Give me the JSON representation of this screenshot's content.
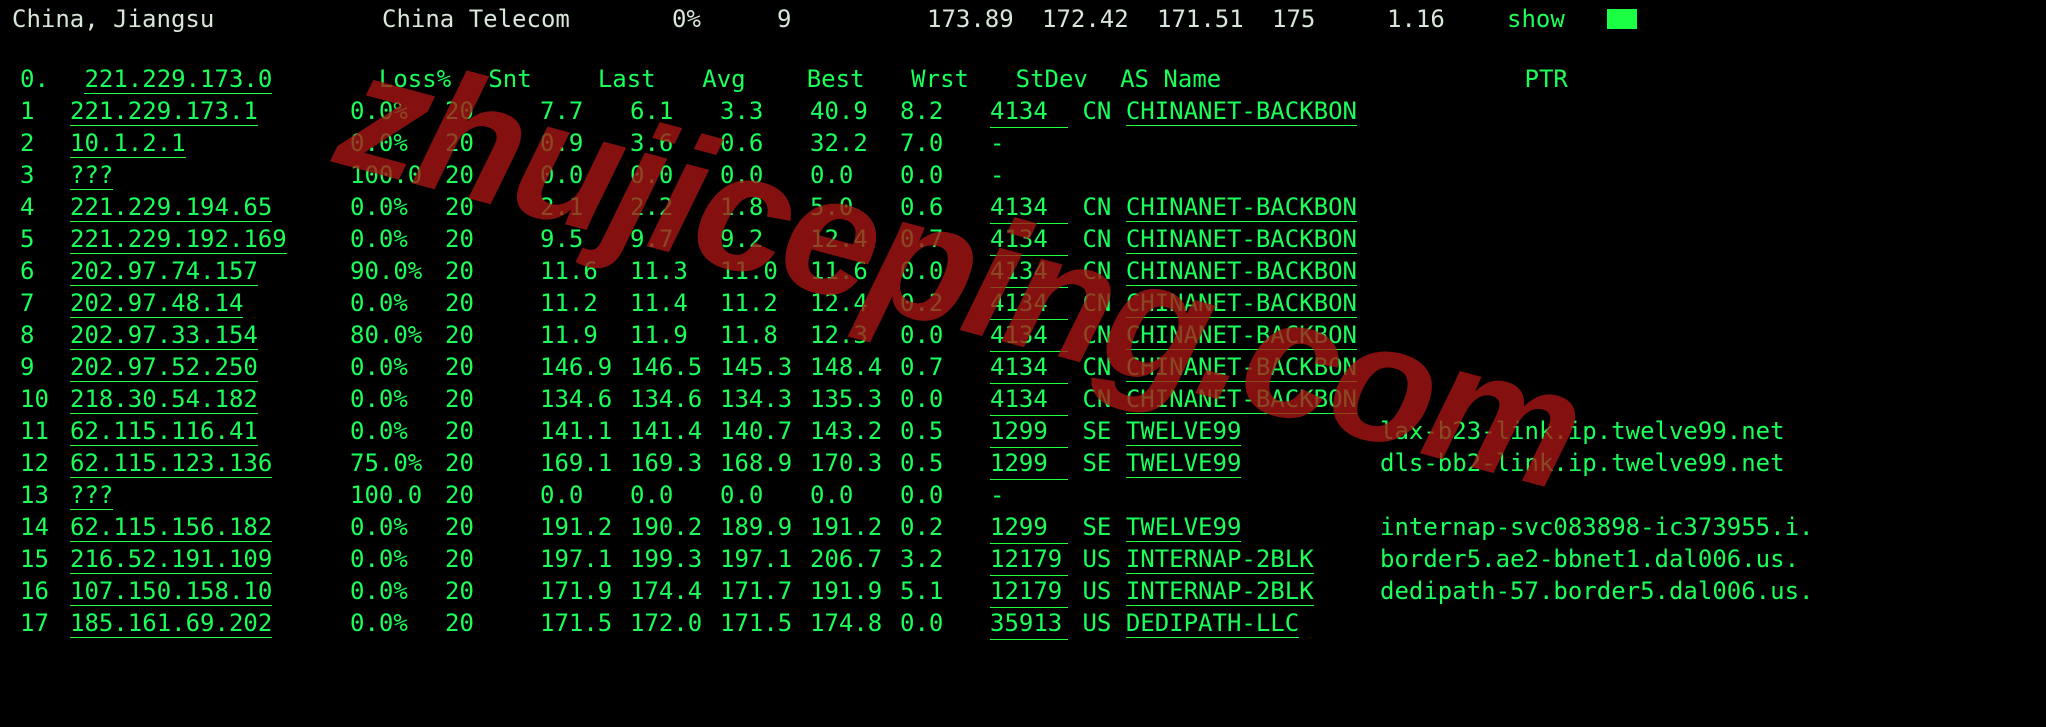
{
  "top": {
    "location": "China, Jiangsu",
    "isp": "China Telecom",
    "loss": "0%",
    "snt": "9",
    "last": "173.89",
    "avg": "172.42",
    "best": "171.51",
    "wrst": "175",
    "stdev": "1.16",
    "action": "show"
  },
  "headers": {
    "hop": "0.",
    "ip": "221.229.173.0",
    "loss": "Loss%",
    "snt": "Snt",
    "last": "Last",
    "avg": "Avg",
    "best": "Best",
    "wrst": "Wrst",
    "stdev": "StDev",
    "asname": "AS Name",
    "ptr": "PTR"
  },
  "hops": [
    {
      "n": "1",
      "ip": "221.229.173.1",
      "loss": "0.0%",
      "snt": "20",
      "last": "7.7",
      "avg": "6.1",
      "best": "3.3",
      "wrst": "40.9",
      "stdev": "8.2",
      "asn": "4134",
      "cc": "CN",
      "asname": "CHINANET-BACKBON",
      "ptr": ""
    },
    {
      "n": "2",
      "ip": "10.1.2.1",
      "loss": "0.0%",
      "snt": "20",
      "last": "0.9",
      "avg": "3.6",
      "best": "0.6",
      "wrst": "32.2",
      "stdev": "7.0",
      "asn": "-",
      "cc": "",
      "asname": "",
      "ptr": ""
    },
    {
      "n": "3",
      "ip": "???",
      "loss": "100.0",
      "snt": "20",
      "last": "0.0",
      "avg": "0.0",
      "best": "0.0",
      "wrst": "0.0",
      "stdev": "0.0",
      "asn": "-",
      "cc": "",
      "asname": "",
      "ptr": ""
    },
    {
      "n": "4",
      "ip": "221.229.194.65",
      "loss": "0.0%",
      "snt": "20",
      "last": "2.1",
      "avg": "2.2",
      "best": "1.8",
      "wrst": "5.0",
      "stdev": "0.6",
      "asn": "4134",
      "cc": "CN",
      "asname": "CHINANET-BACKBON",
      "ptr": ""
    },
    {
      "n": "5",
      "ip": "221.229.192.169",
      "loss": "0.0%",
      "snt": "20",
      "last": "9.5",
      "avg": "9.7",
      "best": "9.2",
      "wrst": "12.4",
      "stdev": "0.7",
      "asn": "4134",
      "cc": "CN",
      "asname": "CHINANET-BACKBON",
      "ptr": ""
    },
    {
      "n": "6",
      "ip": "202.97.74.157",
      "loss": "90.0%",
      "snt": "20",
      "last": "11.6",
      "avg": "11.3",
      "best": "11.0",
      "wrst": "11.6",
      "stdev": "0.0",
      "asn": "4134",
      "cc": "CN",
      "asname": "CHINANET-BACKBON",
      "ptr": ""
    },
    {
      "n": "7",
      "ip": "202.97.48.14",
      "loss": "0.0%",
      "snt": "20",
      "last": "11.2",
      "avg": "11.4",
      "best": "11.2",
      "wrst": "12.4",
      "stdev": "0.2",
      "asn": "4134",
      "cc": "CN",
      "asname": "CHINANET-BACKBON",
      "ptr": ""
    },
    {
      "n": "8",
      "ip": "202.97.33.154",
      "loss": "80.0%",
      "snt": "20",
      "last": "11.9",
      "avg": "11.9",
      "best": "11.8",
      "wrst": "12.3",
      "stdev": "0.0",
      "asn": "4134",
      "cc": "CN",
      "asname": "CHINANET-BACKBON",
      "ptr": ""
    },
    {
      "n": "9",
      "ip": "202.97.52.250",
      "loss": "0.0%",
      "snt": "20",
      "last": "146.9",
      "avg": "146.5",
      "best": "145.3",
      "wrst": "148.4",
      "stdev": "0.7",
      "asn": "4134",
      "cc": "CN",
      "asname": "CHINANET-BACKBON",
      "ptr": ""
    },
    {
      "n": "10",
      "ip": "218.30.54.182",
      "loss": "0.0%",
      "snt": "20",
      "last": "134.6",
      "avg": "134.6",
      "best": "134.3",
      "wrst": "135.3",
      "stdev": "0.0",
      "asn": "4134",
      "cc": "CN",
      "asname": "CHINANET-BACKBON",
      "ptr": ""
    },
    {
      "n": "11",
      "ip": "62.115.116.41",
      "loss": "0.0%",
      "snt": "20",
      "last": "141.1",
      "avg": "141.4",
      "best": "140.7",
      "wrst": "143.2",
      "stdev": "0.5",
      "asn": "1299",
      "cc": "SE",
      "asname": "TWELVE99",
      "ptr": "lax-b23-link.ip.twelve99.net"
    },
    {
      "n": "12",
      "ip": "62.115.123.136",
      "loss": "75.0%",
      "snt": "20",
      "last": "169.1",
      "avg": "169.3",
      "best": "168.9",
      "wrst": "170.3",
      "stdev": "0.5",
      "asn": "1299",
      "cc": "SE",
      "asname": "TWELVE99",
      "ptr": "dls-bb2-link.ip.twelve99.net"
    },
    {
      "n": "13",
      "ip": "???",
      "loss": "100.0",
      "snt": "20",
      "last": "0.0",
      "avg": "0.0",
      "best": "0.0",
      "wrst": "0.0",
      "stdev": "0.0",
      "asn": "-",
      "cc": "",
      "asname": "",
      "ptr": ""
    },
    {
      "n": "14",
      "ip": "62.115.156.182",
      "loss": "0.0%",
      "snt": "20",
      "last": "191.2",
      "avg": "190.2",
      "best": "189.9",
      "wrst": "191.2",
      "stdev": "0.2",
      "asn": "1299",
      "cc": "SE",
      "asname": "TWELVE99",
      "ptr": "internap-svc083898-ic373955.i."
    },
    {
      "n": "15",
      "ip": "216.52.191.109",
      "loss": "0.0%",
      "snt": "20",
      "last": "197.1",
      "avg": "199.3",
      "best": "197.1",
      "wrst": "206.7",
      "stdev": "3.2",
      "asn": "12179",
      "cc": "US",
      "asname": "INTERNAP-2BLK",
      "ptr": "border5.ae2-bbnet1.dal006.us."
    },
    {
      "n": "16",
      "ip": "107.150.158.10",
      "loss": "0.0%",
      "snt": "20",
      "last": "171.9",
      "avg": "174.4",
      "best": "171.7",
      "wrst": "191.9",
      "stdev": "5.1",
      "asn": "12179",
      "cc": "US",
      "asname": "INTERNAP-2BLK",
      "ptr": "dedipath-57.border5.dal006.us."
    },
    {
      "n": "17",
      "ip": "185.161.69.202",
      "loss": "0.0%",
      "snt": "20",
      "last": "171.5",
      "avg": "172.0",
      "best": "171.5",
      "wrst": "174.8",
      "stdev": "0.0",
      "asn": "35913",
      "cc": "US",
      "asname": "DEDIPATH-LLC",
      "ptr": ""
    }
  ],
  "watermark": "zhujiceping.com"
}
